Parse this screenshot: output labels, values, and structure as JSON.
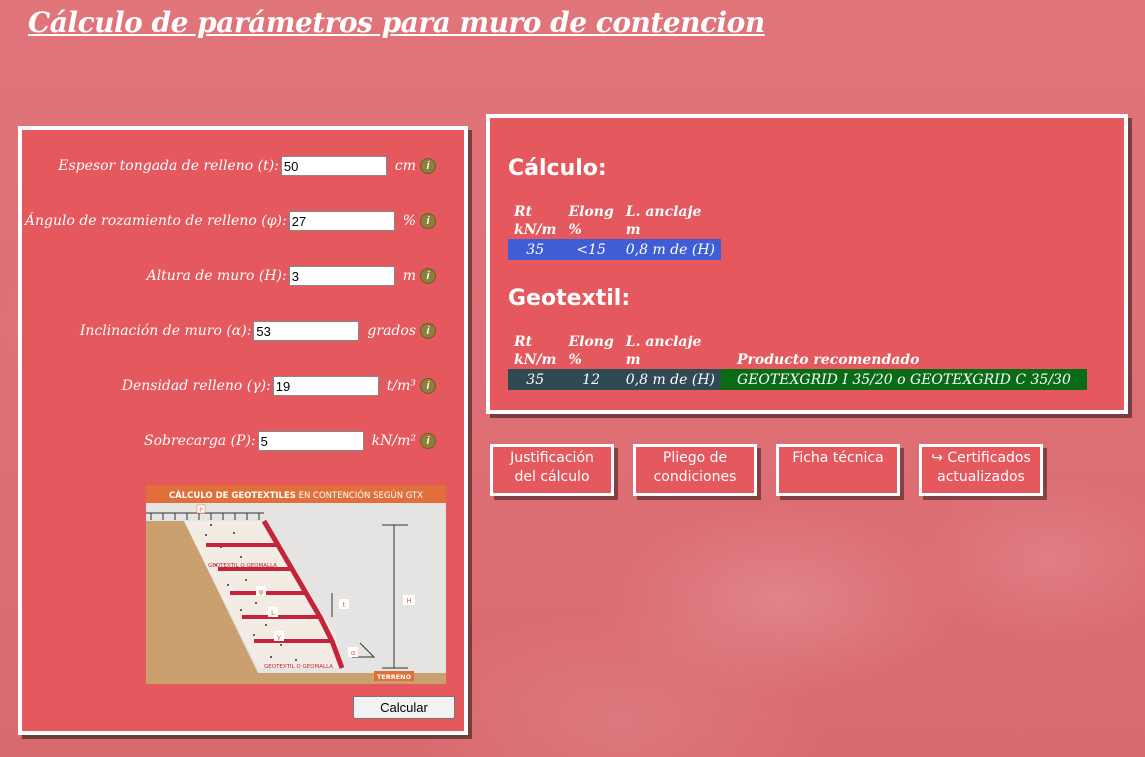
{
  "header": {
    "title": "Cálculo de parámetros para muro de contencion"
  },
  "form": {
    "fields": [
      {
        "label": "Espesor tongada de relleno (t):",
        "value": "50",
        "unit": "cm"
      },
      {
        "label": "Ángulo de rozamiento de relleno (φ):",
        "value": "27",
        "unit": "%"
      },
      {
        "label": "Altura de muro (H):",
        "value": "3",
        "unit": "m"
      },
      {
        "label": "Inclinación de muro (α):",
        "value": "53",
        "unit": "grados"
      },
      {
        "label": "Densidad relleno (γ):",
        "value": "19",
        "unit": "t/m³"
      },
      {
        "label": "Sobrecarga (P):",
        "value": "5",
        "unit": "kN/m²"
      }
    ],
    "info_glyph": "i",
    "diagram": {
      "title_bold": "CÁLCULO DE GEOTEXTILES",
      "title_rest": " EN CONTENCIÓN SEGÚN GTX",
      "p": "P",
      "h": "H",
      "t": "t",
      "phi": "φ",
      "l": "L",
      "gamma": "γ",
      "alpha": "α",
      "geo1": "GEOTEXTIL O GEOMALLA",
      "geo2": "GEOTEXTIL O GEOMALLA",
      "terreno": "TERRENO"
    },
    "submit_label": "Calcular"
  },
  "calculo": {
    "title": "Cálculo:",
    "headers": [
      [
        "Rt",
        "kN/m"
      ],
      [
        "Elong",
        "%"
      ],
      [
        "L. anclaje",
        "m"
      ]
    ],
    "row": [
      "35",
      "<15",
      "0,8 m de (H)"
    ]
  },
  "geotextil": {
    "title": "Geotextil:",
    "headers": [
      [
        "Rt",
        "kN/m"
      ],
      [
        "Elong",
        "%"
      ],
      [
        "L. anclaje",
        "m"
      ],
      [
        "Producto recomendado",
        ""
      ]
    ],
    "row": [
      "35",
      "12",
      "0,8 m de (H)",
      "GEOTEXGRID I 35/20 o GEOTEXGRID C 35/30"
    ]
  },
  "links": [
    {
      "line1": "Justificación",
      "line2": "del cálculo"
    },
    {
      "line1": "Pliego de",
      "line2": "condiciones"
    },
    {
      "line1": "Ficha técnica",
      "line2": ""
    },
    {
      "line1": "↪ Certificados",
      "line2": "actualizados"
    }
  ],
  "colors": {
    "panel": "#e5585e",
    "calc_row": "#3f5ed6",
    "geo_row": "#2e4a52",
    "product": "#0a6b16",
    "info_icon": "#8e7e3a"
  }
}
